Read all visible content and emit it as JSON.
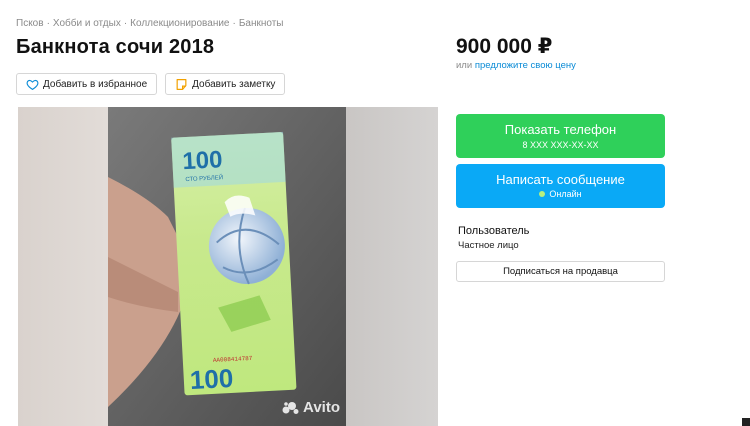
{
  "breadcrumb": {
    "items": [
      "Псков",
      "Хобби и отдых",
      "Коллекционирование",
      "Банкноты"
    ],
    "separator": "·"
  },
  "listing": {
    "title": "Банкнота сочи 2018",
    "favorite_label": "Добавить в избранное",
    "note_label": "Добавить заметку"
  },
  "gallery": {
    "watermark": "Avito",
    "banknote": {
      "denomination": "100",
      "caption": "СТО РУБЛЕЙ",
      "serial": "АА008414787"
    }
  },
  "pricing": {
    "price": "900 000 ₽",
    "offer_prefix": "или",
    "offer_link": "предложите свою цену"
  },
  "contact": {
    "phone_button": "Показать телефон",
    "phone_masked": "8 XXX XXX-XX-XX",
    "message_button": "Написать сообщение",
    "status": "Онлайн"
  },
  "seller": {
    "name": "Пользователь",
    "type": "Частное лицо",
    "subscribe_label": "Подписаться на продавца"
  },
  "colors": {
    "green": "#2fd05a",
    "blue": "#0aa9f6",
    "link": "#0a8bd6",
    "online": "#b6f07e"
  },
  "icons": [
    "heart-icon",
    "note-icon",
    "avito-logo-icon",
    "online-dot-icon"
  ]
}
